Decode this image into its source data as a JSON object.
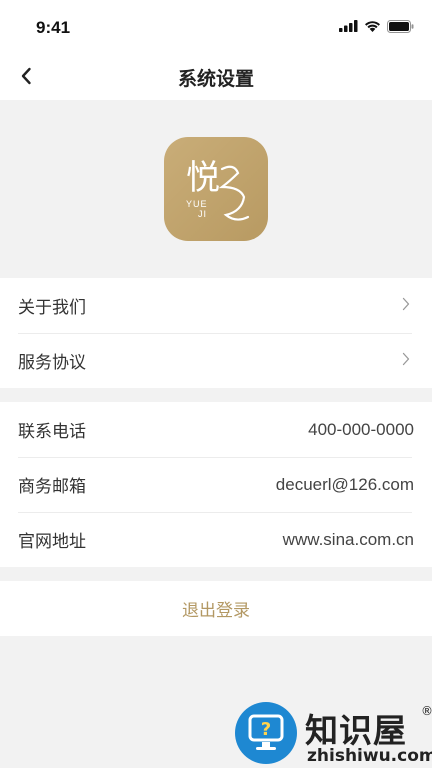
{
  "status_bar": {
    "time": "9:41"
  },
  "nav": {
    "title": "系统设置"
  },
  "logo": {
    "brand_cn": "悦",
    "brand_en_1": "YUE",
    "brand_en_2": "JI"
  },
  "menu_group": {
    "items": [
      {
        "label": "关于我们"
      },
      {
        "label": "服务协议"
      }
    ]
  },
  "info_group": {
    "items": [
      {
        "label": "联系电话",
        "value": "400-000-0000"
      },
      {
        "label": "商务邮箱",
        "value": "decuerl@126.com"
      },
      {
        "label": "官网地址",
        "value": "www.sina.com.cn"
      }
    ]
  },
  "logout": {
    "label": "退出登录"
  },
  "watermark": {
    "title": "知识屋",
    "reg": "®",
    "subtitle": "zhishiwu.com",
    "glyph": "?"
  },
  "colors": {
    "accent": "#b39863",
    "logo_bg": "#c2a56e",
    "watermark_blue": "#1e88d2"
  }
}
